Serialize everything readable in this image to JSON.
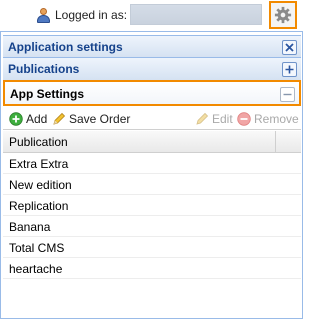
{
  "topbar": {
    "login_label": "Logged in as:",
    "login_value": ""
  },
  "sections": {
    "app_settings_title": "Application settings",
    "publications_title": "Publications",
    "app_settings_sub_title": "App Settings"
  },
  "toolbar": {
    "add_label": "Add",
    "save_order_label": "Save Order",
    "edit_label": "Edit",
    "remove_label": "Remove"
  },
  "grid": {
    "column_header": "Publication",
    "rows": [
      "Extra Extra",
      "New edition",
      "Replication",
      "Banana",
      "Total CMS",
      "heartache"
    ]
  },
  "colors": {
    "highlight": "#f28a00",
    "header_text": "#15428b",
    "panel_border": "#99bbe8"
  },
  "icons": {
    "user": "user-icon",
    "gear": "gear-icon",
    "close": "close-icon",
    "expand": "plus-icon",
    "collapse": "minus-icon",
    "add": "add-icon",
    "save_order": "pencil-icon",
    "edit": "pencil-icon",
    "remove": "remove-icon"
  }
}
